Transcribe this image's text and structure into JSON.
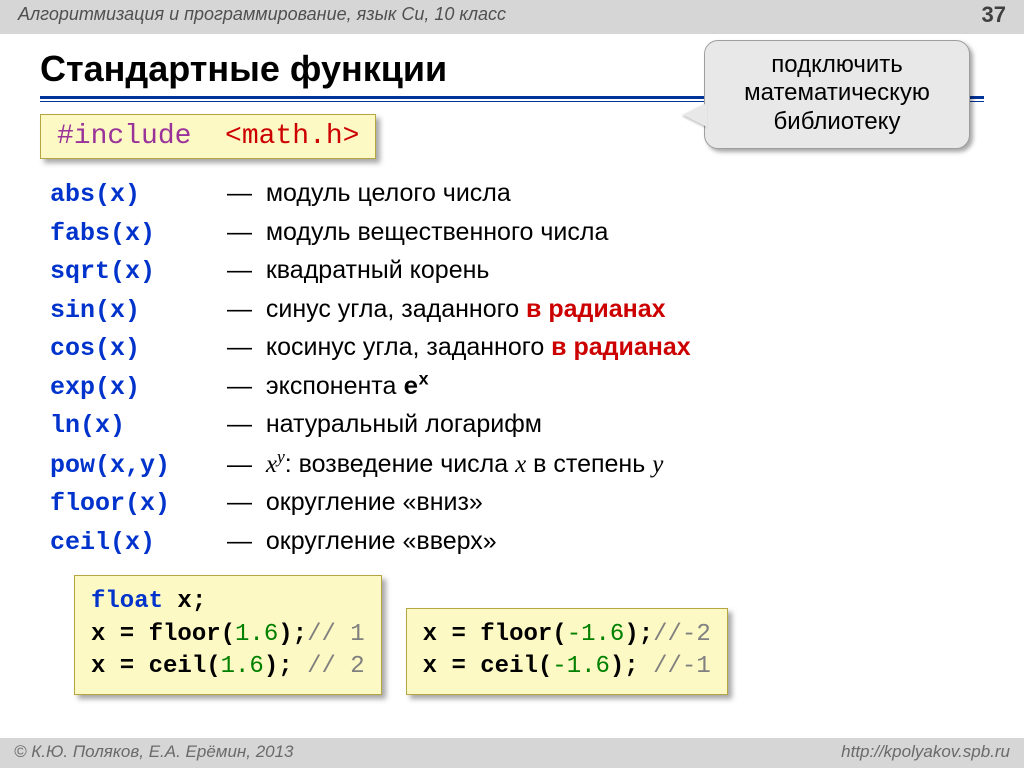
{
  "header": {
    "breadcrumb": "Алгоритмизация и программирование, язык Си, 10 класс",
    "page": "37"
  },
  "title": "Стандартные функции",
  "callout": {
    "l1": "подключить",
    "l2": "математическую",
    "l3": "библиотеку"
  },
  "include": {
    "kw": "#include",
    "arg": "<math.h>"
  },
  "funcs": [
    {
      "name": "abs(x)",
      "desc_pre": "модуль целого числа",
      "red": "",
      "desc_post": ""
    },
    {
      "name": "fabs(x)",
      "desc_pre": "модуль вещественного числа",
      "red": "",
      "desc_post": ""
    },
    {
      "name": "sqrt(x)",
      "desc_pre": "квадратный корень",
      "red": "",
      "desc_post": ""
    },
    {
      "name": "sin(x)",
      "desc_pre": "синус угла, заданного ",
      "red": "в радианах",
      "desc_post": ""
    },
    {
      "name": "cos(x)",
      "desc_pre": "косинус угла, заданного ",
      "red": "в радианах",
      "desc_post": ""
    },
    {
      "name": "exp(x)",
      "desc_pre": "экспонента ",
      "red": "",
      "desc_post": "",
      "mono": "e",
      "sup": "x"
    },
    {
      "name": "ln(x)",
      "desc_pre": "натуральный логарифм",
      "red": "",
      "desc_post": ""
    },
    {
      "name": "pow(x,y)",
      "desc_pre": "",
      "red": "",
      "desc_post": ": возведение числа ",
      "ital_a": "x",
      "sup2": "y",
      "ital_b": "x",
      "desc_post2": " в степень ",
      "ital_c": "y"
    },
    {
      "name": "floor(x)",
      "desc_pre": "округление «вниз»",
      "red": "",
      "desc_post": ""
    },
    {
      "name": "ceil(x)",
      "desc_pre": "округление «вверх»",
      "red": "",
      "desc_post": ""
    }
  ],
  "dash": "—",
  "code1": {
    "l1_kw": "float",
    "l1_rest": " x;",
    "l2_a": "x = floor(",
    "l2_num": "1.6",
    "l2_b": ");",
    "l2_c": "// 1",
    "l3_a": "x = ceil(",
    "l3_num": "1.6",
    "l3_b": "); ",
    "l3_c": "// 2"
  },
  "code2": {
    "l1_a": "x = floor(",
    "l1_num": "-1.6",
    "l1_b": ");",
    "l1_c": "//-2",
    "l2_a": "x = ceil(",
    "l2_num": "-1.6",
    "l2_b": "); ",
    "l2_c": "//-1"
  },
  "footer": {
    "left": "© К.Ю. Поляков, Е.А. Ерёмин, 2013",
    "right": "http://kpolyakov.spb.ru"
  }
}
